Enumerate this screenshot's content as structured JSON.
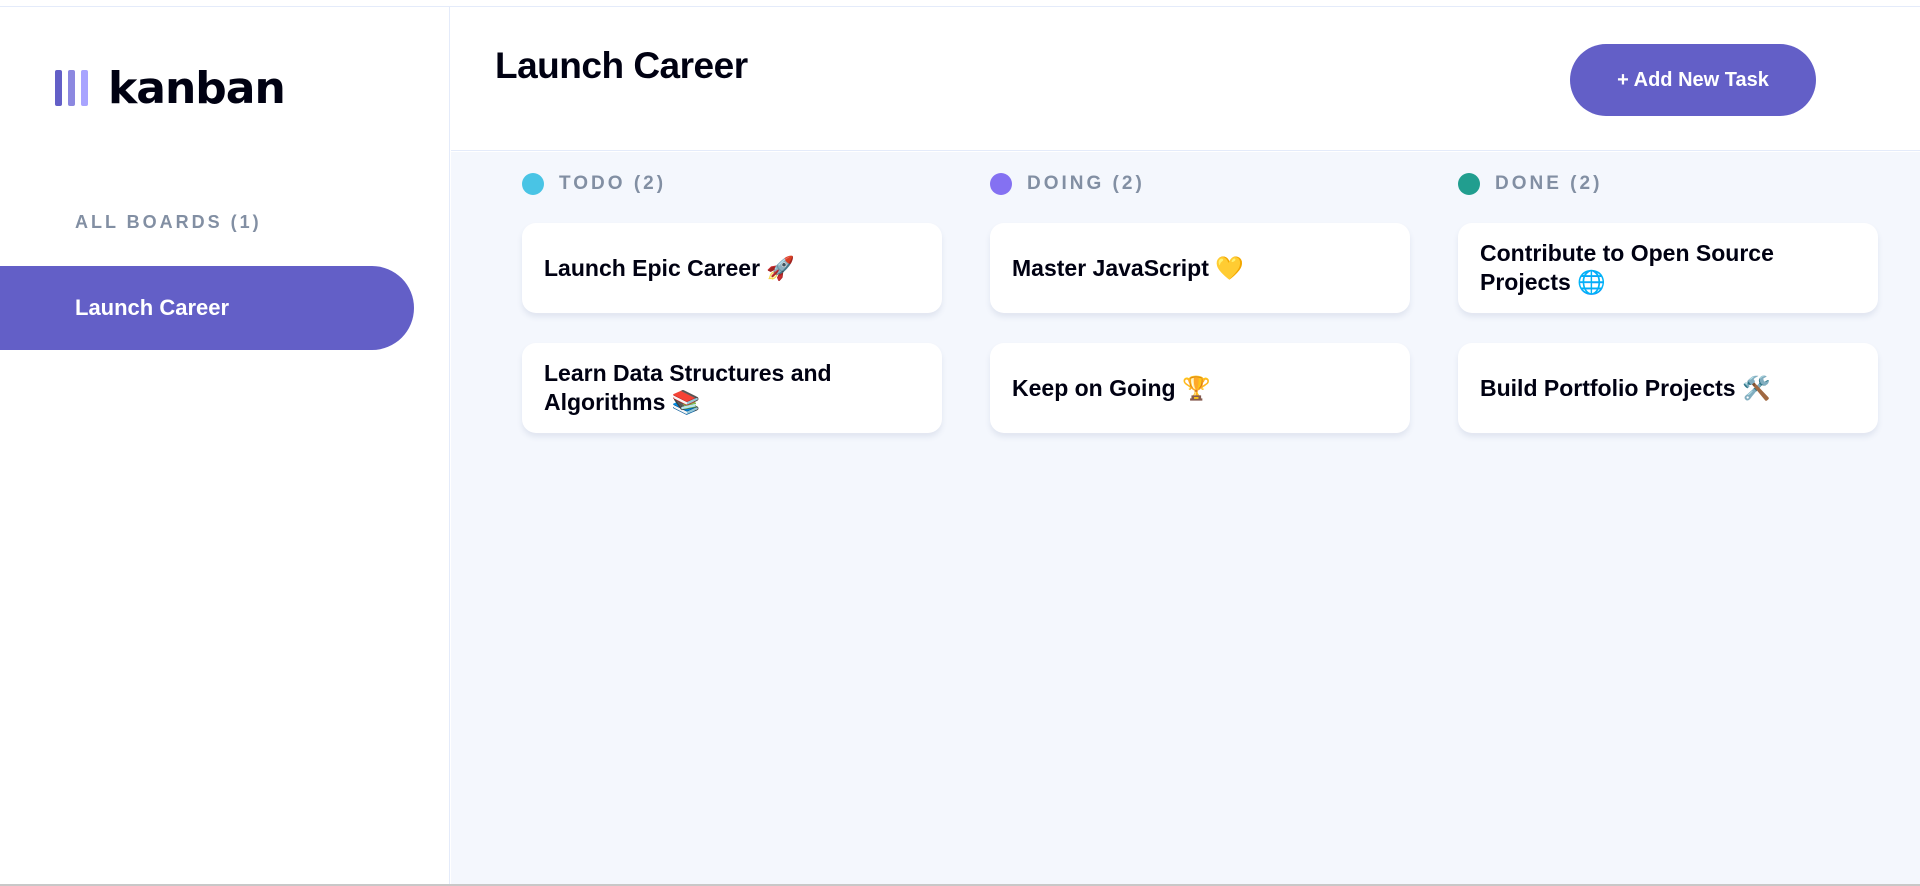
{
  "app": {
    "logo_text": "kanban",
    "logo_bar_colors": [
      "#635fc7",
      "#8c88e0",
      "#a8a4ff"
    ]
  },
  "sidebar": {
    "heading": "ALL BOARDS (1)",
    "boards": [
      {
        "label": "Launch Career",
        "active": true
      }
    ]
  },
  "header": {
    "title": "Launch Career",
    "add_task_label": "+ Add New Task"
  },
  "colors": {
    "accent": "#635fc7",
    "board_background": "#f4f7fd",
    "todo_dot": "#49c4e5",
    "doing_dot": "#8471f2",
    "done_dot": "#219e8f",
    "muted_text": "#828fa3"
  },
  "columns": [
    {
      "title": "TODO (2)",
      "dot_color": "#49c4e5",
      "tasks": [
        {
          "title": "Launch Epic Career 🚀"
        },
        {
          "title": "Learn Data Structures and Algorithms 📚"
        }
      ]
    },
    {
      "title": "DOING (2)",
      "dot_color": "#8471f2",
      "tasks": [
        {
          "title": "Master JavaScript 💛"
        },
        {
          "title": "Keep on Going 🏆"
        }
      ]
    },
    {
      "title": "DONE (2)",
      "dot_color": "#219e8f",
      "tasks": [
        {
          "title": "Contribute to Open Source Projects 🌐"
        },
        {
          "title": "Build Portfolio Projects 🛠️"
        }
      ]
    }
  ]
}
